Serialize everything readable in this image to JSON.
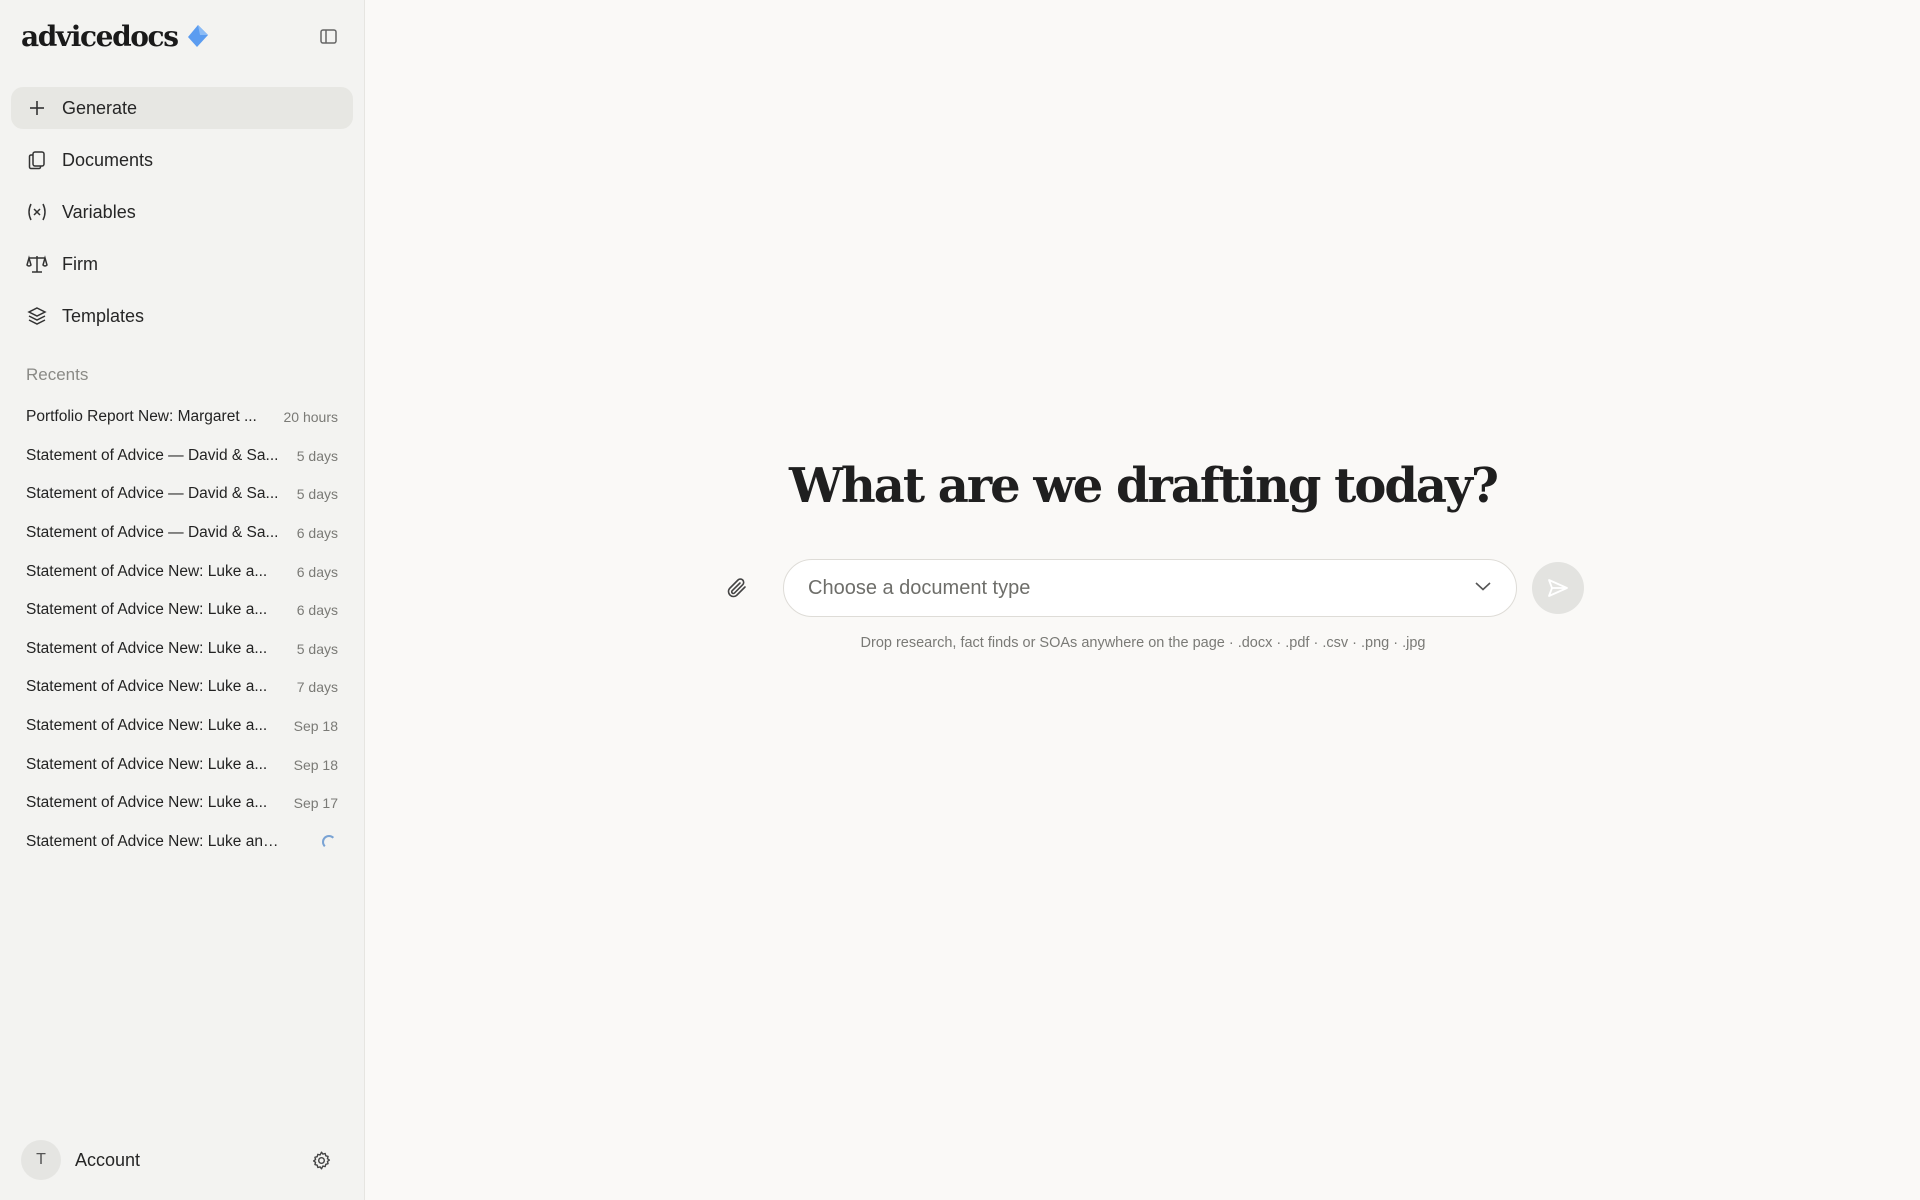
{
  "brand": {
    "name": "advicedocs",
    "accent": "#5b9cf0"
  },
  "nav": {
    "items": [
      {
        "label": "Generate",
        "icon": "plus-icon"
      },
      {
        "label": "Documents",
        "icon": "documents-icon"
      },
      {
        "label": "Variables",
        "icon": "variable-icon"
      },
      {
        "label": "Firm",
        "icon": "scales-icon"
      },
      {
        "label": "Templates",
        "icon": "layers-icon"
      }
    ]
  },
  "recents": {
    "title": "Recents",
    "items": [
      {
        "title": "Portfolio Report New: Margaret ...",
        "time": "20 hours"
      },
      {
        "title": "Statement of Advice — David & Sa...",
        "time": "5 days"
      },
      {
        "title": "Statement of Advice — David & Sa...",
        "time": "5 days"
      },
      {
        "title": "Statement of Advice — David & Sa...",
        "time": "6 days"
      },
      {
        "title": "Statement of Advice New: Luke a...",
        "time": "6 days"
      },
      {
        "title": "Statement of Advice New: Luke a...",
        "time": "6 days"
      },
      {
        "title": "Statement of Advice New: Luke a...",
        "time": "5 days"
      },
      {
        "title": "Statement of Advice New: Luke a...",
        "time": "7 days"
      },
      {
        "title": "Statement of Advice New: Luke a...",
        "time": "Sep 18"
      },
      {
        "title": "Statement of Advice New: Luke a...",
        "time": "Sep 18"
      },
      {
        "title": "Statement of Advice New: Luke a...",
        "time": "Sep 17"
      },
      {
        "title": "Statement of Advice New: Luke and ...",
        "time": "",
        "loading": true
      }
    ]
  },
  "account": {
    "initial": "T",
    "label": "Account"
  },
  "main": {
    "headline": "What are we drafting today?",
    "select_placeholder": "Choose a document type",
    "hint": "Drop research, fact finds or SOAs anywhere on the page · .docx · .pdf · .csv · .png · .jpg"
  }
}
